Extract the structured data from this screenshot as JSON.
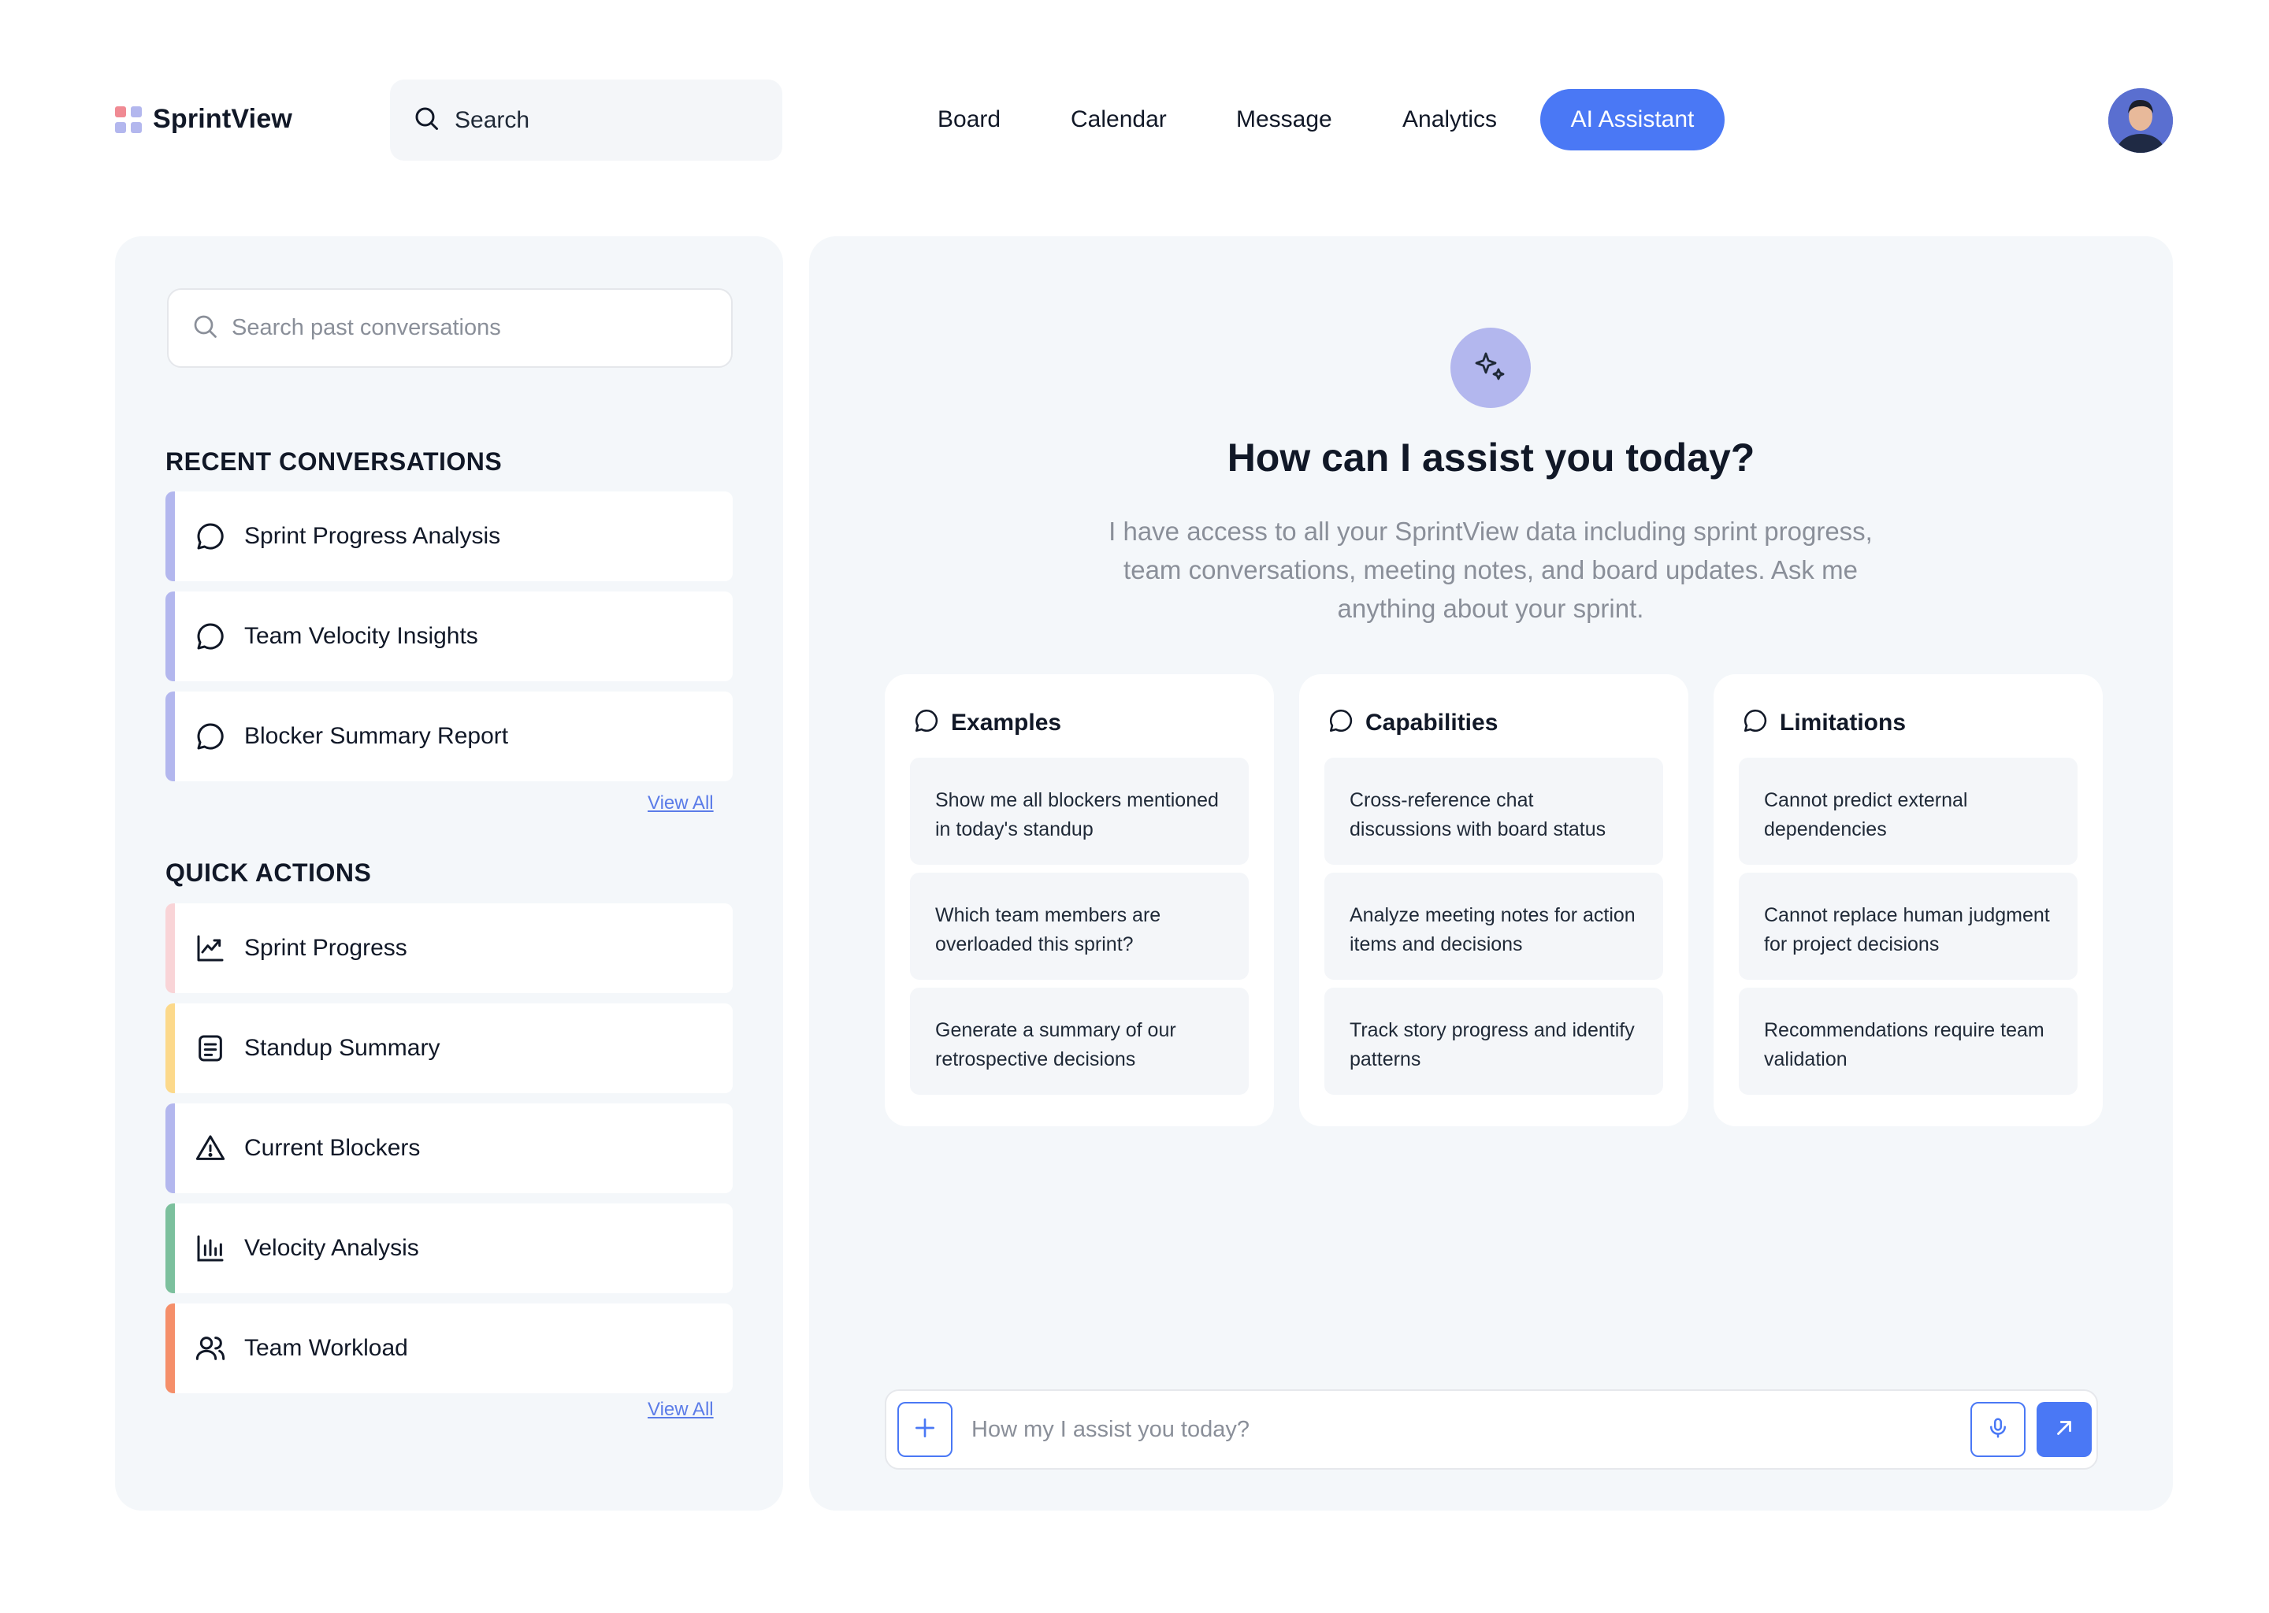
{
  "brand": {
    "name": "SprintView",
    "mark_colors": [
      "#f08a93",
      "#b3b7ee",
      "#b3b7ee",
      "#b3b7ee"
    ]
  },
  "top_search": {
    "label": "Search"
  },
  "nav": {
    "items": [
      {
        "label": "Board"
      },
      {
        "label": "Calendar"
      },
      {
        "label": "Message"
      },
      {
        "label": "Analytics"
      },
      {
        "label": "AI Assistant",
        "active": true
      }
    ]
  },
  "sidebar": {
    "search_placeholder": "Search past conversations",
    "recent_title": "RECENT CONVERSATIONS",
    "recent": [
      {
        "label": "Sprint Progress Analysis",
        "icon": "chat-bubble-icon",
        "accent": "#b3b7ee"
      },
      {
        "label": "Team Velocity Insights",
        "icon": "chat-bubble-icon",
        "accent": "#b3b7ee"
      },
      {
        "label": "Blocker Summary Report",
        "icon": "chat-bubble-icon",
        "accent": "#b3b7ee"
      }
    ],
    "recent_view_all": "View All",
    "quick_title": "QUICK ACTIONS",
    "quick": [
      {
        "label": "Sprint Progress",
        "icon": "trend-chart-icon",
        "accent": "#f9d4d7"
      },
      {
        "label": "Standup Summary",
        "icon": "document-icon",
        "accent": "#fcd98b"
      },
      {
        "label": "Current Blockers",
        "icon": "warning-icon",
        "accent": "#b3b7ee"
      },
      {
        "label": "Velocity Analysis",
        "icon": "bar-chart-icon",
        "accent": "#7cc09d"
      },
      {
        "label": "Team Workload",
        "icon": "users-icon",
        "accent": "#f58f6a"
      }
    ],
    "quick_view_all": "View All"
  },
  "assistant": {
    "headline": "How can I assist you today?",
    "description": "I have access to all your SprintView data including sprint progress, team conversations, meeting notes, and board updates. Ask me anything about your sprint.",
    "cards": [
      {
        "title": "Examples",
        "items": [
          "Show me all blockers mentioned in today's standup",
          "Which team members are overloaded this sprint?",
          "Generate a summary of our retrospective decisions"
        ]
      },
      {
        "title": "Capabilities",
        "items": [
          "Cross-reference chat discussions with board status",
          "Analyze meeting notes for action items and decisions",
          "Track story progress and identify patterns"
        ]
      },
      {
        "title": "Limitations",
        "items": [
          "Cannot predict external dependencies",
          "Cannot replace human judgment for project decisions",
          "Recommendations require team validation"
        ]
      }
    ],
    "input_placeholder": "How my I assist you today?"
  },
  "colors": {
    "accent": "#4a78f5",
    "panel": "#f4f7fa"
  }
}
